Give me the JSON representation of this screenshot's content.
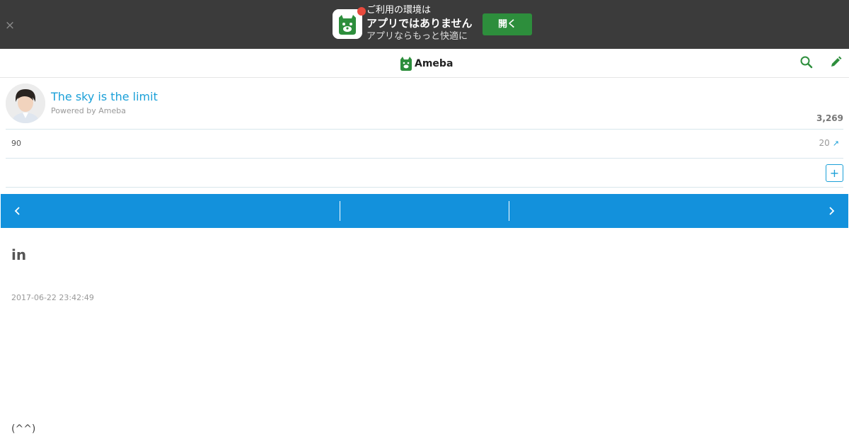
{
  "banner": {
    "line1": "ご利用の環境は",
    "line2": "アプリではありません",
    "line3": "アプリならもっと快適に",
    "open_label": "開く",
    "close_symbol": "×"
  },
  "header": {
    "logo_text": "Ameba"
  },
  "profile": {
    "blog_title": "The sky is the limit",
    "powered_by": "Powered by Ameba",
    "follower_count": "3,269"
  },
  "stats": {
    "left_value": "90",
    "right_value": "20",
    "trend_symbol": "↗"
  },
  "follow": {
    "plus_symbol": "+"
  },
  "entry": {
    "title": "in",
    "date": "2017-06-22 23:42:49",
    "body": "(^^)"
  },
  "colors": {
    "brand_green": "#2d8e3c",
    "link_blue": "#1ba0d8",
    "nav_blue": "#1391dc",
    "banner_dark": "#3b3b3b"
  }
}
